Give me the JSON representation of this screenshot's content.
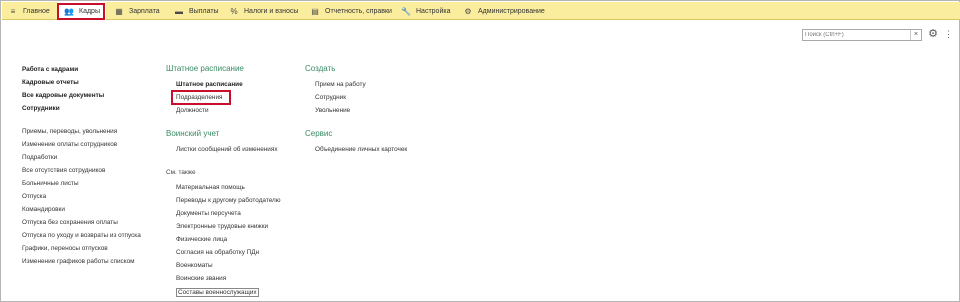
{
  "menu": {
    "items": [
      {
        "label": "Главное",
        "icon": "hamburger-icon"
      },
      {
        "label": "Кадры",
        "icon": "people-icon"
      },
      {
        "label": "Зарплата",
        "icon": "calculator-icon"
      },
      {
        "label": "Выплаты",
        "icon": "card-icon"
      },
      {
        "label": "Налоги и взносы",
        "icon": "percent-icon"
      },
      {
        "label": "Отчетность, справки",
        "icon": "report-icon"
      },
      {
        "label": "Настройка",
        "icon": "wrench-icon"
      },
      {
        "label": "Администрирование",
        "icon": "admin-icon"
      }
    ]
  },
  "search": {
    "placeholder": "Поиск (Ctrl+F)",
    "clear": "×"
  },
  "left": {
    "bold": [
      "Работа с кадрами",
      "Кадровые отчеты",
      "Все кадровые документы",
      "Сотрудники"
    ],
    "links": [
      "Приемы, переводы, увольнения",
      "Изменение оплаты сотрудников",
      "Подработки",
      "Все отсутствия сотрудников",
      "Больничные листы",
      "Отпуска",
      "Командировки",
      "Отпуска без сохранения оплаты",
      "Отпуска по уходу и возвраты из отпуска",
      "Графики, переносы отпусков",
      "Изменение графиков работы списком"
    ]
  },
  "mid": {
    "staff_header": "Штатное расписание",
    "staff_items": [
      "Штатное расписание",
      "Подразделения",
      "Должности"
    ],
    "military_header": "Воинский учет",
    "military_items": [
      "Листки сообщений об изменениях"
    ],
    "see_also": "См. также",
    "see_items": [
      "Материальная помощь",
      "Переводы к другому работодателю",
      "Документы персучета",
      "Электронные трудовые книжки",
      "Физические лица",
      "Согласия на обработку ПДн",
      "Военкоматы",
      "Воинские звания",
      "Составы военнослужащих"
    ]
  },
  "right": {
    "create_header": "Создать",
    "create_items": [
      "Прием на работу",
      "Сотрудник",
      "Увольнение"
    ],
    "service_header": "Сервис",
    "service_items": [
      "Объединение личных карточек"
    ]
  },
  "colors": {
    "topbar": "#fbed9e",
    "section_header": "#3a8a64",
    "highlight": "#c8102e"
  }
}
